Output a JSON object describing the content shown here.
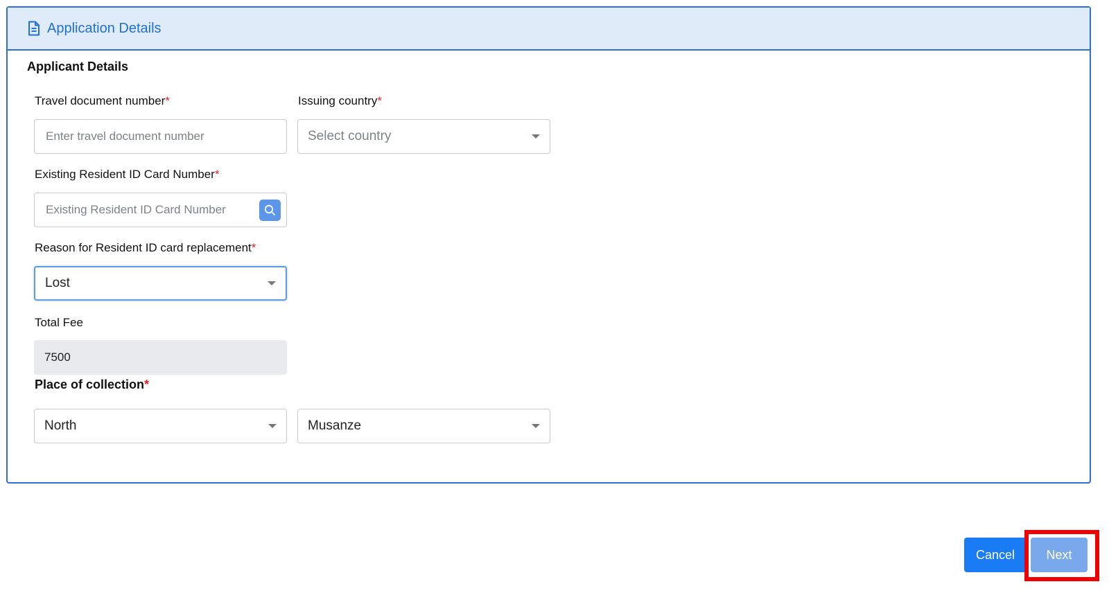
{
  "header": {
    "title": "Application Details",
    "icon": "document-icon"
  },
  "section": {
    "title": "Applicant Details"
  },
  "fields": {
    "travel_doc": {
      "label": "Travel document number",
      "placeholder": "Enter travel document number",
      "value": ""
    },
    "issuing_country": {
      "label": "Issuing country",
      "placeholder": "Select country"
    },
    "resident_id": {
      "label": "Existing Resident ID Card Number",
      "placeholder": "Existing Resident ID Card Number",
      "value": ""
    },
    "reason": {
      "label": "Reason for Resident ID card replacement",
      "value": "Lost"
    },
    "total_fee": {
      "label": "Total Fee",
      "value": "7500"
    },
    "collection": {
      "label": "Place of collection",
      "province": "North",
      "district": "Musanze"
    }
  },
  "required_marker": "*",
  "buttons": {
    "cancel": "Cancel",
    "next": "Next"
  },
  "colors": {
    "accent": "#1e6fd9",
    "header_bg": "#e0ebf9",
    "required": "#e0202a",
    "highlight": "#f00000"
  }
}
